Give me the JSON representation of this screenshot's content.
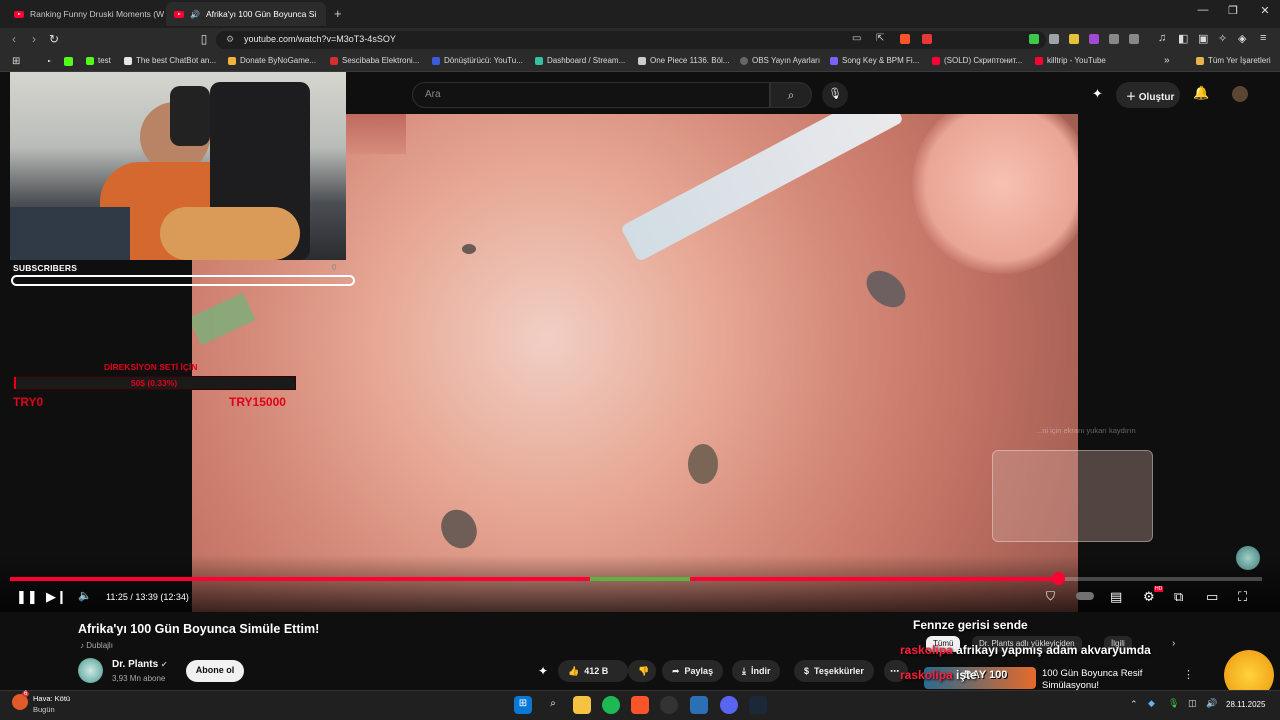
{
  "browser": {
    "tabs": [
      {
        "label": "Ranking Funny Druski Moments (Wa",
        "active": false
      },
      {
        "label": "Afrika'yı 100 Gün Boyunca Si",
        "active": true
      }
    ],
    "new_tab": "+",
    "url": "youtube.com/watch?v=M3oT3-4sSOY",
    "bookmarks": [
      {
        "label": "test"
      },
      {
        "label": "The best ChatBot an..."
      },
      {
        "label": "Donate ByNoGame..."
      },
      {
        "label": "Sescibaba Elektroni..."
      },
      {
        "label": "Dönüştürücü: YouTu..."
      },
      {
        "label": "Dashboard / Stream..."
      },
      {
        "label": "One Piece 1136. Böl..."
      },
      {
        "label": "OBS Yayın Ayarları"
      },
      {
        "label": "Song Key & BPM Fi..."
      },
      {
        "label": "(SOLD) Скриптонит..."
      },
      {
        "label": "killtrip - YouTube"
      }
    ],
    "all_bookmarks": "Tüm Yer İşaretleri",
    "more": "»"
  },
  "youtube": {
    "search_placeholder": "Ara",
    "create_label": "Oluştur"
  },
  "overlay": {
    "subscribers_label": "SUBSCRIBERS",
    "subscribers_count": "0",
    "goal_title": "DİREKSİYON SETİ İÇİN",
    "goal_value": "50$ (0.33%)",
    "goal_progress": 0.0033,
    "goal_min": "TRY0",
    "goal_max": "TRY15000",
    "endcard_text": "...ni için ekranı yukarı kaydırın"
  },
  "player": {
    "time": "11:25 / 13:39 (12:34)",
    "progress": 0.837,
    "hd_badge": "HD"
  },
  "video": {
    "title": "Afrika'yı 100 Gün Boyunca Simüle Ettim!",
    "dubbed": "Dublajlı",
    "channel": "Dr. Plants",
    "subscribers": "3,93 Mn abone",
    "subscribe": "Abone ol",
    "likes": "412 B",
    "share": "Paylaş",
    "download": "İndir",
    "thanks": "Teşekkürler",
    "more": "⋯"
  },
  "chat": [
    {
      "user": "Fennze",
      "msg": "gerisi sende",
      "color": "#ffffff"
    },
    {
      "user": "raskolipa",
      "msg": "afrikayı yapmış adam akvaryumda",
      "color": "#ff1e3c"
    },
    {
      "user": "raskolipa",
      "msg": "işte",
      "color": "#ff1e3c"
    }
  ],
  "chips": [
    {
      "label": "Tümü",
      "active": true
    },
    {
      "label": "Dr. Plants adlı yükleyiciden",
      "active": false
    },
    {
      "label": "İlgili",
      "active": false
    }
  ],
  "recommendation": {
    "title": "100 Gün Boyunca Resif Simülasyonu!",
    "thumb_text": "DAY 100"
  },
  "taskbar": {
    "weather_title": "Hava: Kötü",
    "weather_sub": "Bugün",
    "weather_badge": "6",
    "clock": "28.11.2025"
  },
  "colors": {
    "accent": "#ff0033",
    "progress_segment": "#5fb141",
    "overlay_red": "#e0001a"
  }
}
